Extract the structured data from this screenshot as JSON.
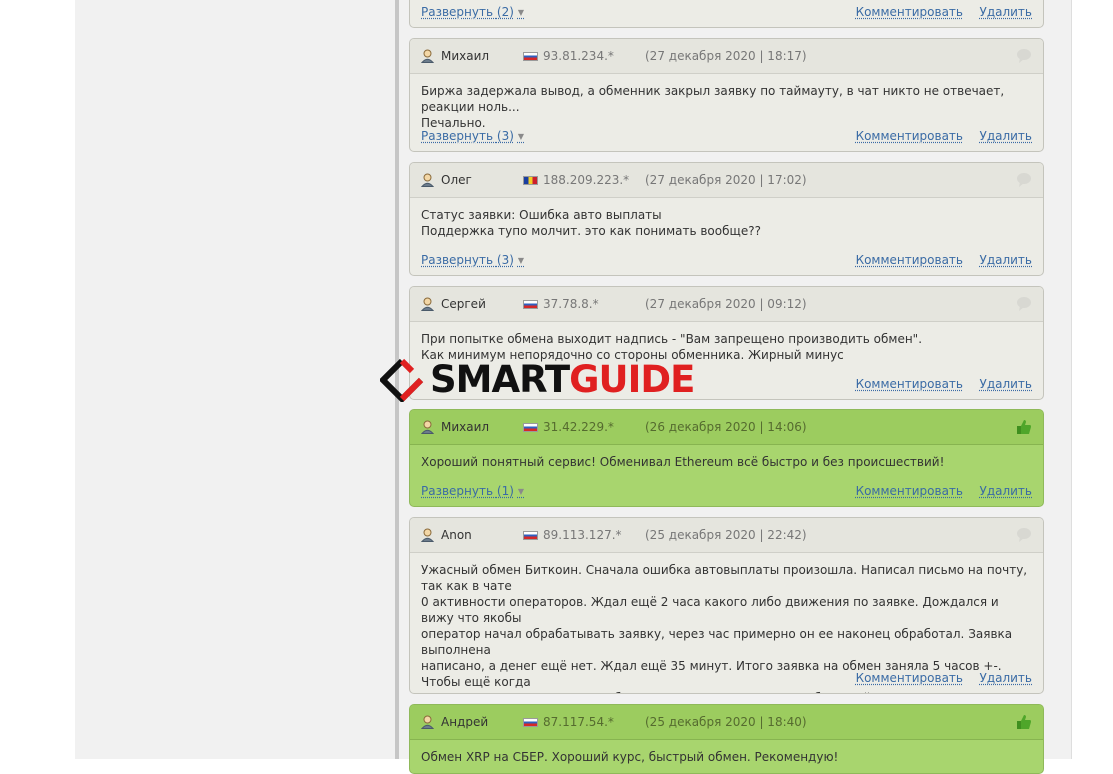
{
  "common": {
    "expand_label": "Развернуть",
    "comment_label": "Комментировать",
    "delete_label": "Удалить"
  },
  "reviews": [
    {
      "author": "",
      "ip": "",
      "date": "",
      "flag": "",
      "sentiment": "",
      "text": "",
      "expand_count": "(2)"
    },
    {
      "author": "Михаил",
      "ip": "93.81.234.*",
      "date": "(27 декабря 2020 | 18:17)",
      "flag": "ru",
      "sentiment": "neutral",
      "text": "Биржа задержала вывод, а обменник закрыл заявку по таймауту, в чат никто не отвечает, реакции ноль...\nПечально.",
      "expand_count": "(3)"
    },
    {
      "author": "Олег",
      "ip": "188.209.223.*",
      "date": "(27 декабря 2020 | 17:02)",
      "flag": "md",
      "sentiment": "neutral",
      "text": "Статус заявки: Ошибка авто выплаты\nПоддержка тупо молчит. это как понимать вообще??",
      "expand_count": "(3)"
    },
    {
      "author": "Сергей",
      "ip": "37.78.8.*",
      "date": "(27 декабря 2020 | 09:12)",
      "flag": "ru",
      "sentiment": "neutral",
      "text": "При попытке обмена выходит надпись - \"Вам запрещено производить обмен\".\nКак минимум непорядочно со стороны обменника. Жирный минус",
      "expand_count": ""
    },
    {
      "author": "Михаил",
      "ip": "31.42.229.*",
      "date": "(26 декабря 2020 | 14:06)",
      "flag": "ru",
      "sentiment": "positive",
      "text": "Хороший понятный сервис! Обменивал Ethereum всё быстро и без происшествий!",
      "expand_count": "(1)"
    },
    {
      "author": "Anon",
      "ip": "89.113.127.*",
      "date": "(25 декабря 2020 | 22:42)",
      "flag": "ru",
      "sentiment": "neutral",
      "text": "Ужасный обмен Биткоин. Сначала ошибка автовыплаты произошла. Написал письмо на почту, так как в чате\n0 активности операторов. Ждал ещё 2 часа какого либо движения по заявке. Дождался и вижу что якобы\nоператор начал обрабатывать заявку, через час примерно он ее наконец обработал. Заявка выполнена\nнаписано, а денег ещё нет. Ждал ещё 35 минут. Итого заявка на обмен заняла 5 часов +-. Чтобы ещё когда\nто доверил средства такому обменнику, никогда... Ни один обменный пункт так долго не решал ситуацию\nпо заявке, писал в чат если наблюдал проблему и тут же все решалось",
      "expand_count": ""
    },
    {
      "author": "Андрей",
      "ip": "87.117.54.*",
      "date": "(25 декабря 2020 | 18:40)",
      "flag": "ru",
      "sentiment": "positive",
      "text": "Обмен XRP на СБЕР. Хороший курс, быстрый обмен. Рекомендую!",
      "expand_count": ""
    }
  ],
  "watermark": {
    "part1": "SMART",
    "part2": "GUIDE",
    "color_dark": "#111111",
    "color_red": "#e02020"
  },
  "colors": {
    "neutral_card": "#ecece6",
    "positive_card": "#a8d56e",
    "link": "#3a6ba5"
  }
}
